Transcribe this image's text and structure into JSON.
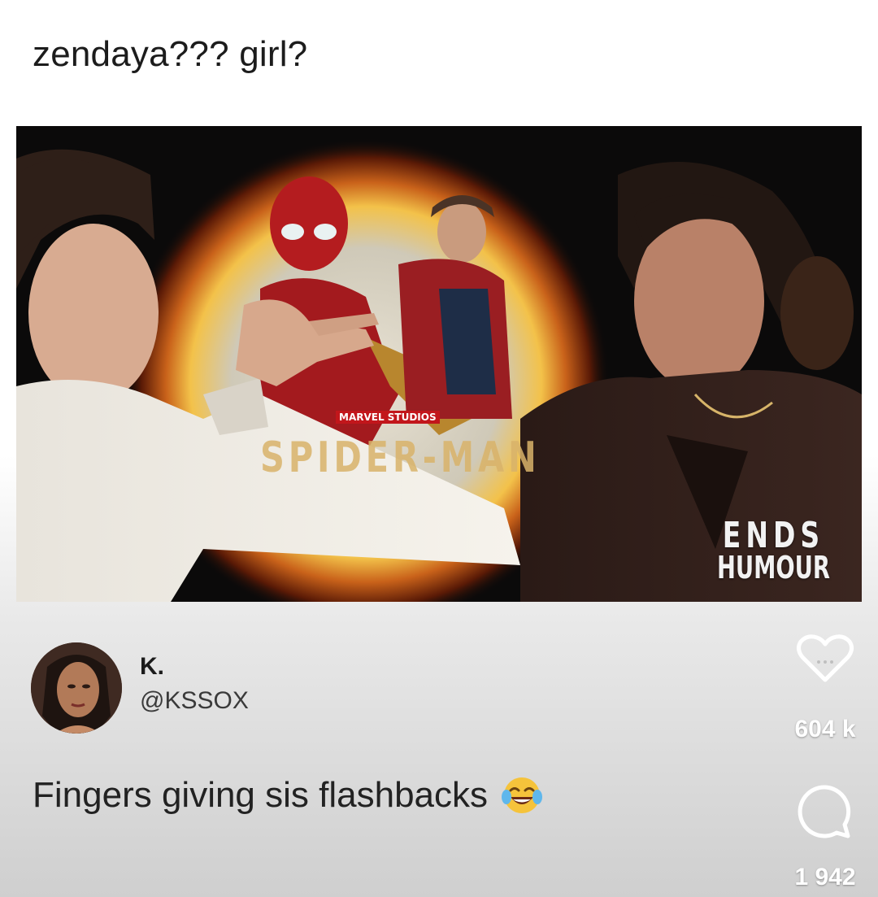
{
  "post": {
    "caption": "zendaya??? girl?"
  },
  "video": {
    "studio_label": "MARVEL STUDIOS",
    "poster_title": "SPIDER-MAN",
    "watermark_line1": "ENDS",
    "watermark_line2": "HUMOUR"
  },
  "tweet": {
    "display_name": "K.",
    "handle": "@KSSOX",
    "text": "Fingers giving sis flashbacks",
    "emoji": "face-with-tears-of-joy"
  },
  "actions": {
    "like_count": "604 k",
    "comment_count": "1 942",
    "like_icon": "heart-icon",
    "comment_icon": "comment-bubble-icon"
  },
  "colors": {
    "text_primary": "#1c1c1c",
    "action_text": "#ffffff",
    "video_bg": "#0b0a0a"
  }
}
